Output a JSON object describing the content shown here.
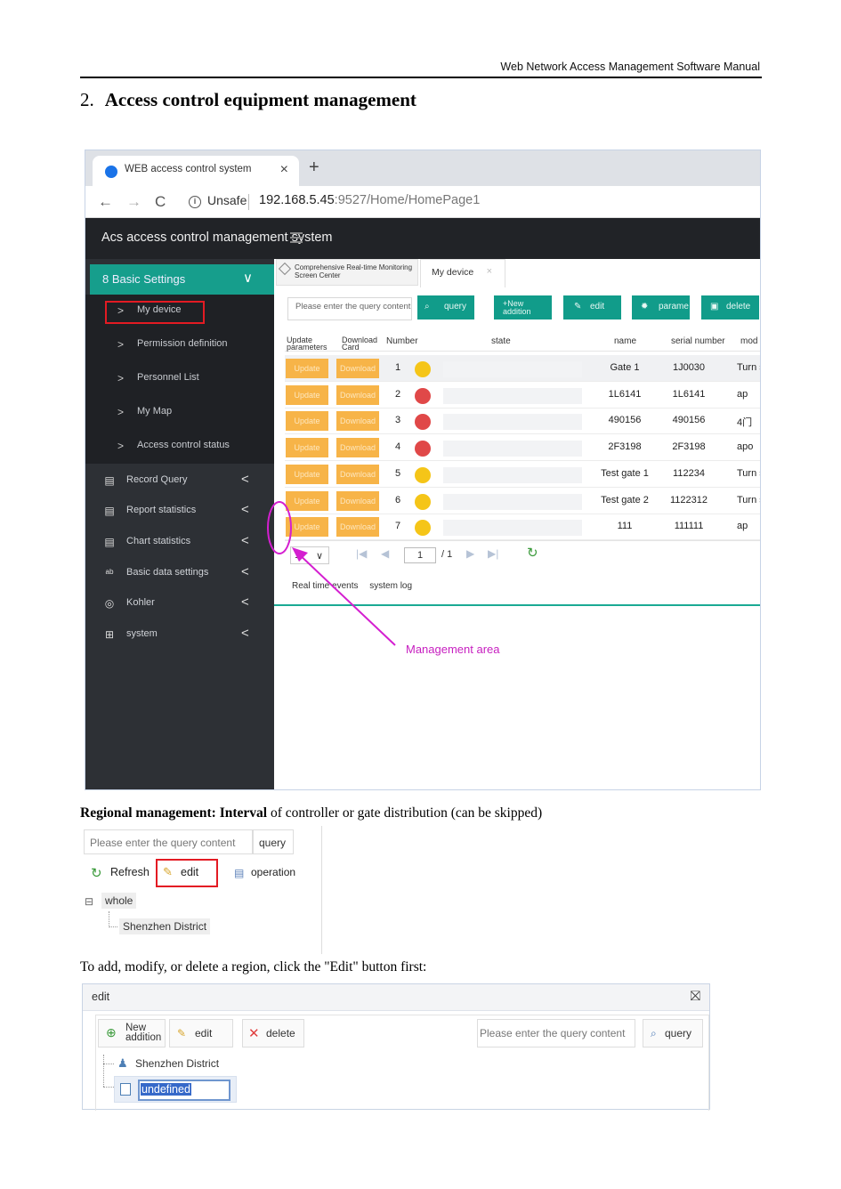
{
  "page_header": "Web  Network Access Management Software Manual",
  "section": {
    "number": "2.",
    "title": "Access control equipment management"
  },
  "browser": {
    "tab_title": "WEB access control system",
    "tab_close": "×",
    "new_tab": "+",
    "back": "←",
    "forward": "→",
    "reload": "C",
    "info": "i",
    "security": "Unsafe",
    "url_host": "192.168.5.45",
    "url_path": ":9527/Home/HomePage1"
  },
  "app": {
    "title": "Acs access control management system",
    "sidebar": {
      "group": "8 Basic Settings",
      "group_arrow": "∨",
      "sub_items": [
        "My device",
        "Permission definition",
        "Personnel List",
        "My Map",
        "Access control status"
      ],
      "menu_items": [
        {
          "label": "Record Query",
          "icon": "▤"
        },
        {
          "label": "Report statistics",
          "icon": "▤"
        },
        {
          "label": "Chart statistics",
          "icon": "▤"
        },
        {
          "label": "Basic data settings",
          "icon": "ᵃᵇ"
        },
        {
          "label": "Kohler",
          "icon": "◎"
        },
        {
          "label": "system",
          "icon": "⊞"
        }
      ],
      "chevron": ">",
      "collapse": "<"
    },
    "tabs": {
      "first": "Comprehensive Real-time Monitoring Screen Center",
      "second": "My device",
      "close": "×"
    },
    "toolbar": {
      "search_placeholder": "Please enter the query content",
      "query": "query",
      "new": "+New addition",
      "edit": "edit",
      "params": "parame",
      "delete": "delete"
    },
    "table": {
      "headers": [
        "Update parameters",
        "Download Card",
        "Number",
        "state",
        "name",
        "serial number",
        "mod"
      ],
      "button_update": "Update parameters",
      "button_download": "Download Card",
      "rows": [
        {
          "num": "1",
          "status": "yellow",
          "name": "Gate 1",
          "serial": "1J0030",
          "model": "Turn stile"
        },
        {
          "num": "2",
          "status": "red",
          "name": "1L6141",
          "serial": "1L6141",
          "model": "ap"
        },
        {
          "num": "3",
          "status": "red",
          "name": "490156",
          "serial": "490156",
          "model": "4门"
        },
        {
          "num": "4",
          "status": "red",
          "name": "2F3198",
          "serial": "2F3198",
          "model": "apo"
        },
        {
          "num": "5",
          "status": "yellow",
          "name": "Test gate 1",
          "serial": "112234",
          "model": "Turn stile"
        },
        {
          "num": "6",
          "status": "yellow",
          "name": "Test gate 2",
          "serial": "1122312",
          "model": "Turn stile"
        },
        {
          "num": "7",
          "status": "yellow",
          "name": "111",
          "serial": "111111",
          "model": "ap"
        }
      ]
    },
    "pager": {
      "page_size": "1",
      "current": "1",
      "total": "/ 1",
      "first": "|◀",
      "prev": "◀",
      "next": "▶",
      "last": "▶|",
      "refresh": "↻"
    },
    "bottom_tabs": [
      "Real time events",
      "system log"
    ],
    "annotation": "Management area"
  },
  "captions": {
    "regional_bold": "Regional management: Interval",
    "regional_rest": " of controller or gate distribution (can be skipped)",
    "edit_hint": "To add, modify, or delete a region, click the \"Edit\" button first:"
  },
  "region_panel": {
    "search_placeholder": "Please enter the query content",
    "query": "query",
    "refresh": "Refresh",
    "edit": "edit",
    "operation": "operation",
    "tree_toggle": "⊟",
    "root": "whole",
    "child": "Shenzhen District"
  },
  "edit_dialog": {
    "title": "edit",
    "close": "⛝",
    "new": "New addition",
    "edit": "edit",
    "delete": "delete",
    "search_placeholder": "Please enter the query content",
    "query": "query",
    "node": "Shenzhen District",
    "new_node": "undefined"
  },
  "colors": {
    "teal": "#169e8c",
    "orange": "#f7b448",
    "yellow": "#f5c518",
    "red": "#e04848",
    "magenta": "#e01ad6",
    "highlight": "#e31b23"
  }
}
